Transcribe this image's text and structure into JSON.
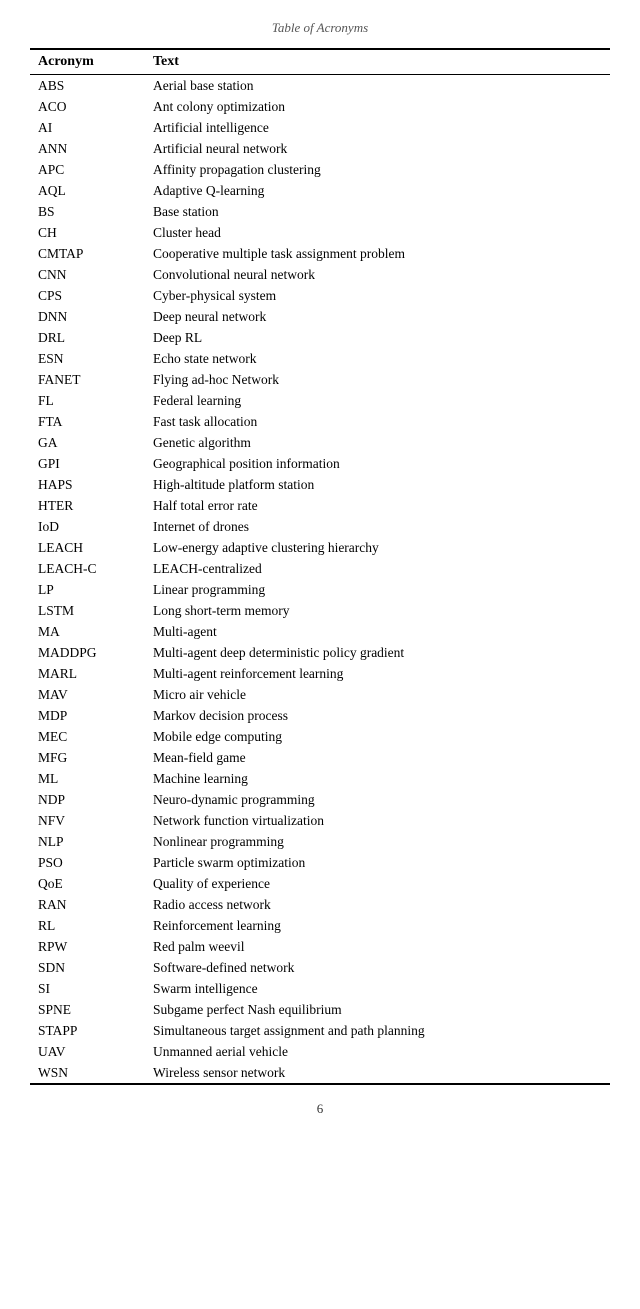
{
  "page": {
    "title": "Table of Acronyms",
    "page_number": "6"
  },
  "table": {
    "headers": [
      "Acronym",
      "Text"
    ],
    "rows": [
      [
        "ABS",
        "Aerial base station"
      ],
      [
        "ACO",
        "Ant colony optimization"
      ],
      [
        "AI",
        "Artificial intelligence"
      ],
      [
        "ANN",
        "Artificial neural network"
      ],
      [
        "APC",
        "Affinity propagation clustering"
      ],
      [
        "AQL",
        "Adaptive Q-learning"
      ],
      [
        "BS",
        "Base station"
      ],
      [
        "CH",
        "Cluster head"
      ],
      [
        "CMTAP",
        "Cooperative multiple task assignment problem"
      ],
      [
        "CNN",
        "Convolutional neural network"
      ],
      [
        "CPS",
        "Cyber-physical system"
      ],
      [
        "DNN",
        "Deep neural network"
      ],
      [
        "DRL",
        "Deep RL"
      ],
      [
        "ESN",
        "Echo state network"
      ],
      [
        "FANET",
        "Flying ad-hoc Network"
      ],
      [
        "FL",
        "Federal learning"
      ],
      [
        "FTA",
        "Fast task allocation"
      ],
      [
        "GA",
        "Genetic algorithm"
      ],
      [
        "GPI",
        "Geographical position information"
      ],
      [
        "HAPS",
        "High-altitude platform station"
      ],
      [
        "HTER",
        "Half total error rate"
      ],
      [
        "IoD",
        "Internet of drones"
      ],
      [
        "LEACH",
        "Low-energy adaptive clustering hierarchy"
      ],
      [
        "LEACH-C",
        "LEACH-centralized"
      ],
      [
        "LP",
        "Linear programming"
      ],
      [
        "LSTM",
        "Long short-term memory"
      ],
      [
        "MA",
        "Multi-agent"
      ],
      [
        "MADDPG",
        "Multi-agent deep deterministic policy gradient"
      ],
      [
        "MARL",
        "Multi-agent reinforcement learning"
      ],
      [
        "MAV",
        "Micro air vehicle"
      ],
      [
        "MDP",
        "Markov decision process"
      ],
      [
        "MEC",
        "Mobile edge computing"
      ],
      [
        "MFG",
        "Mean-field game"
      ],
      [
        "ML",
        "Machine learning"
      ],
      [
        "NDP",
        "Neuro-dynamic programming"
      ],
      [
        "NFV",
        "Network function virtualization"
      ],
      [
        "NLP",
        "Nonlinear programming"
      ],
      [
        "PSO",
        "Particle swarm optimization"
      ],
      [
        "QoE",
        "Quality of experience"
      ],
      [
        "RAN",
        "Radio access network"
      ],
      [
        "RL",
        "Reinforcement learning"
      ],
      [
        "RPW",
        "Red palm weevil"
      ],
      [
        "SDN",
        "Software-defined network"
      ],
      [
        "SI",
        "Swarm intelligence"
      ],
      [
        "SPNE",
        "Subgame perfect Nash equilibrium"
      ],
      [
        "STAPP",
        "Simultaneous target assignment and path planning"
      ],
      [
        "UAV",
        "Unmanned aerial vehicle"
      ],
      [
        "WSN",
        "Wireless sensor network"
      ]
    ]
  }
}
